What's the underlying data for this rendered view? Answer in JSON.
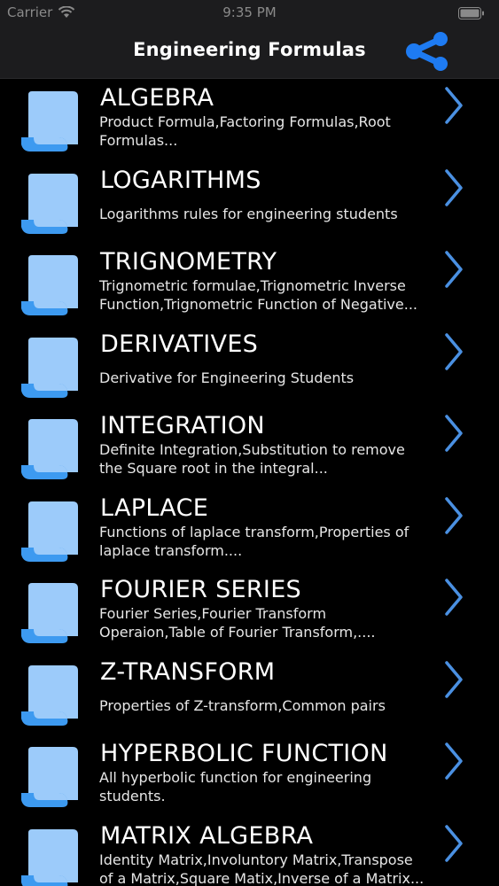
{
  "status_bar": {
    "carrier": "Carrier",
    "time": "9:35 PM"
  },
  "nav": {
    "title": "Engineering Formulas",
    "share_icon": "share-icon"
  },
  "colors": {
    "background": "#000000",
    "bar": "#1c1c1e",
    "accent": "#1e7bf2",
    "doc_icon": "#9ccbfa",
    "doc_icon_fold": "#3d9af0",
    "chevron": "#4a90e2"
  },
  "items": [
    {
      "title": "ALGEBRA",
      "description": "Product Formula,Factoring Formulas,Root Formulas..."
    },
    {
      "title": "LOGARITHMS",
      "description": "Logarithms rules for engineering students"
    },
    {
      "title": "TRIGNOMETRY",
      "description": "Trignometric formulae,Trignometric Inverse Function,Trignometric Function of Negative..."
    },
    {
      "title": "DERIVATIVES",
      "description": "Derivative for Engineering Students"
    },
    {
      "title": "INTEGRATION",
      "description": "Definite Integration,Substitution to remove the Square root in the integral..."
    },
    {
      "title": "LAPLACE",
      "description": "Functions of laplace transform,Properties of laplace transform...."
    },
    {
      "title": "FOURIER SERIES",
      "description": "Fourier Series,Fourier Transform Operaion,Table of Fourier Transform,...."
    },
    {
      "title": "Z-TRANSFORM",
      "description": "Properties of Z-transform,Common pairs"
    },
    {
      "title": "HYPERBOLIC FUNCTION",
      "description": "All hyperbolic function for engineering students."
    },
    {
      "title": "MATRIX ALGEBRA",
      "description": "Identity Matrix,Involuntory Matrix,Transpose of a Matrix,Square Matix,Inverse of a Matrix..."
    }
  ]
}
